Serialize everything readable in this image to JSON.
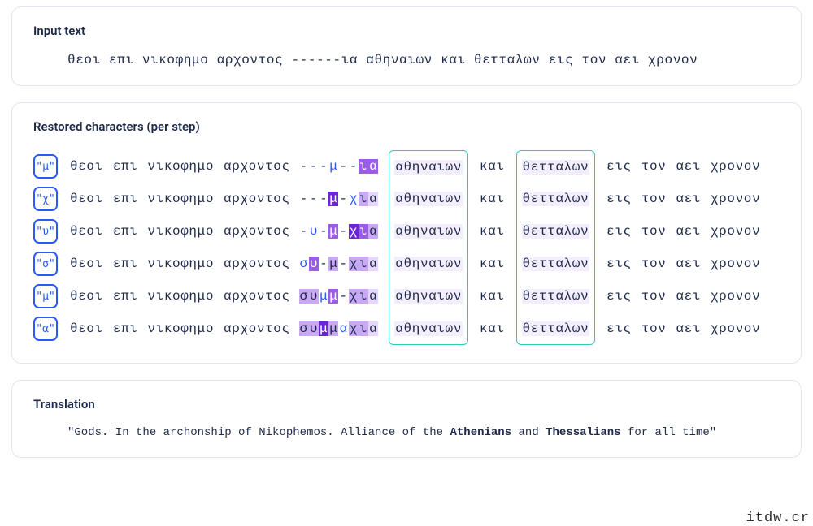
{
  "sections": {
    "input_title": "Input text",
    "restored_title": "Restored characters (per step)",
    "translation_title": "Translation"
  },
  "input_text": "θεοι επι νικοφημο αρχοντος ------ια αθηναιων και θετταλων εις τον αει χρονον",
  "prefix_tokens": [
    "θεοι",
    "επι",
    "νικοφημο",
    "αρχοντος"
  ],
  "boxed_word_1": "αθηναιων",
  "mid_word": "και",
  "boxed_word_2": "θετταλων",
  "suffix_tokens": [
    "εις",
    "τον",
    "αει",
    "χρονον"
  ],
  "steps": [
    {
      "badge": "\"μ\"",
      "mid": [
        {
          "t": "-"
        },
        {
          "t": "-"
        },
        {
          "t": "-"
        },
        {
          "t": "μ",
          "c": "cur"
        },
        {
          "t": "-"
        },
        {
          "t": "-"
        },
        {
          "t": "ι",
          "h": 3
        },
        {
          "t": "α",
          "h": 3
        }
      ]
    },
    {
      "badge": "\"χ\"",
      "mid": [
        {
          "t": "-"
        },
        {
          "t": "-"
        },
        {
          "t": "-"
        },
        {
          "t": "μ",
          "h": 4
        },
        {
          "t": "-"
        },
        {
          "t": "χ",
          "c": "cur"
        },
        {
          "t": "ι",
          "h": 2
        },
        {
          "t": "α",
          "h": 1
        }
      ]
    },
    {
      "badge": "\"υ\"",
      "mid": [
        {
          "t": "-"
        },
        {
          "t": "υ",
          "c": "cur"
        },
        {
          "t": "-"
        },
        {
          "t": "μ",
          "h": 3
        },
        {
          "t": "-"
        },
        {
          "t": "χ",
          "h": 4
        },
        {
          "t": "ι",
          "h": 3
        },
        {
          "t": "α",
          "h": 2
        }
      ]
    },
    {
      "badge": "\"σ\"",
      "mid": [
        {
          "t": "σ",
          "c": "cur"
        },
        {
          "t": "υ",
          "h": 3
        },
        {
          "t": "-"
        },
        {
          "t": "μ",
          "h": 2
        },
        {
          "t": "-"
        },
        {
          "t": "χ",
          "h": 2
        },
        {
          "t": "ι",
          "h": 2
        },
        {
          "t": "α",
          "h": 1
        }
      ]
    },
    {
      "badge": "\"μ\"",
      "mid": [
        {
          "t": "σ",
          "h": 2
        },
        {
          "t": "υ",
          "h": 2
        },
        {
          "t": "μ",
          "c": "cur"
        },
        {
          "t": "μ",
          "h": 3
        },
        {
          "t": "-"
        },
        {
          "t": "χ",
          "h": 2
        },
        {
          "t": "ι",
          "h": 2
        },
        {
          "t": "α",
          "h": 1
        }
      ]
    },
    {
      "badge": "\"α\"",
      "mid": [
        {
          "t": "σ",
          "h": 2
        },
        {
          "t": "υ",
          "h": 2
        },
        {
          "t": "μ",
          "h": 4
        },
        {
          "t": "μ",
          "h": 2
        },
        {
          "t": "α",
          "c": "cur"
        },
        {
          "t": "χ",
          "h": 2
        },
        {
          "t": "ι",
          "h": 2
        },
        {
          "t": "α",
          "h": 1
        }
      ]
    }
  ],
  "translation_before": "\"Gods. In the archonship of Nikophemos. Alliance of the ",
  "translation_bold1": "Athenians",
  "translation_mid": " and ",
  "translation_bold2": "Thessalians",
  "translation_after": " for all time\"",
  "watermark": "itdw.cr"
}
